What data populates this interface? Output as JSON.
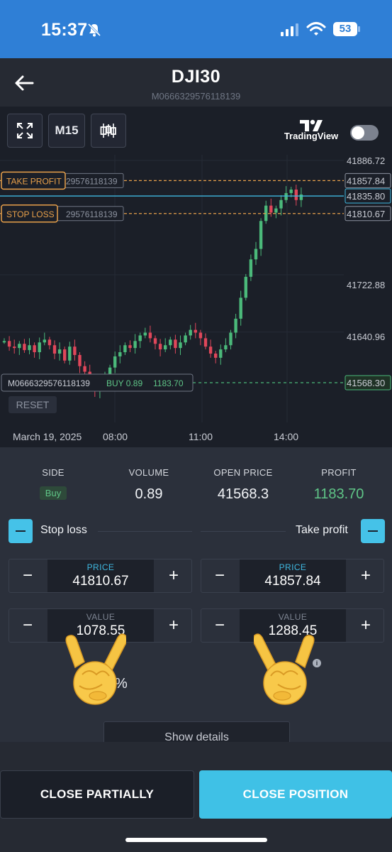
{
  "status_bar": {
    "time": "15:37",
    "battery": "53",
    "icons": [
      "bell-off-icon",
      "cellular-signal-icon",
      "wifi-icon",
      "battery-icon"
    ]
  },
  "header": {
    "title": "DJI30",
    "order_id": "M0666329576118139",
    "back_icon": "arrow-left-icon"
  },
  "toolbar": {
    "timeframe": "M15",
    "fullscreen_icon": "expand-icon",
    "chart_type_icon": "candlestick-icon",
    "brand": "TradingView",
    "brand_toggle_on": false
  },
  "chart": {
    "price_labels": [
      "41886.72",
      "41857.84",
      "41835.80",
      "41810.67",
      "41722.88",
      "41640.96",
      "41568.30"
    ],
    "time_labels": [
      "March 19, 2025",
      "08:00",
      "11:00",
      "14:00"
    ],
    "take_profit_label": "TAKE PROFIT",
    "take_profit_id": "29576118139",
    "stop_loss_label": "STOP LOSS",
    "stop_loss_id": "29576118139",
    "position_line_text": "M0666329576118139",
    "position_side_text": "BUY 0.89",
    "position_profit_text": "1183.70",
    "reset_label": "RESET",
    "colors": {
      "up": "#4bb97a",
      "down": "#e0475a",
      "tp_sl_line": "#e8a04a",
      "current_price": "#3fb8e0",
      "entry_line": "#4bb97a"
    }
  },
  "position": {
    "side_label": "SIDE",
    "side_value": "Buy",
    "volume_label": "VOLUME",
    "volume_value": "0.89",
    "open_price_label": "OPEN PRICE",
    "open_price_value": "41568.3",
    "profit_label": "PROFIT",
    "profit_value": "1183.70"
  },
  "stop_loss": {
    "label": "Stop loss",
    "price_caption": "PRICE",
    "price_value": "41810.67",
    "value_caption": "VALUE",
    "value_value": "1078.55"
  },
  "take_profit": {
    "label": "Take profit",
    "price_caption": "PRICE",
    "price_value": "41857.84",
    "value_caption": "VALUE",
    "value_value": "1288.45"
  },
  "partial_visible": {
    "left_pct": "%"
  },
  "overlay_emoji": "sign-of-horns-emoji",
  "show_details_label": "Show details",
  "actions": {
    "close_partially": "CLOSE PARTIALLY",
    "close_position": "CLOSE POSITION"
  }
}
